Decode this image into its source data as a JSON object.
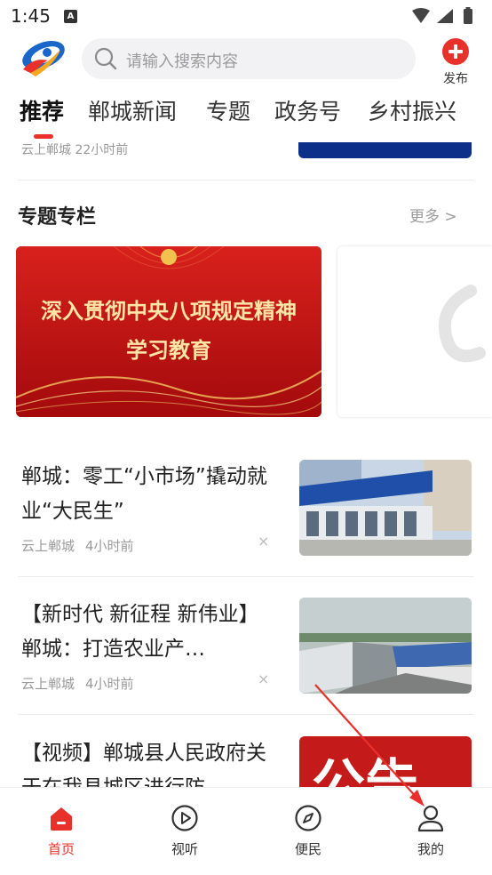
{
  "status_bar": {
    "time": "1:45",
    "notification_letter": "A"
  },
  "header": {
    "search_placeholder": "请输入搜索内容",
    "publish_label": "发布",
    "logo_icon": "app-logo-icon"
  },
  "tabs": [
    {
      "label": "推荐",
      "active": true
    },
    {
      "label": "郸城新闻",
      "active": false
    },
    {
      "label": "专题",
      "active": false
    },
    {
      "label": "政务号",
      "active": false
    },
    {
      "label": "乡村振兴",
      "active": false
    }
  ],
  "previous_item": {
    "meta": "云上郸城  22小时前"
  },
  "topics": {
    "title": "专题专栏",
    "more_label": "更多 >",
    "banner_line1": "深入贯彻中央八项规定精神",
    "banner_line2": "学习教育"
  },
  "news": [
    {
      "title": "郸城：零工“小市场”撬动就业“大民生”",
      "source": "云上郸城",
      "time": "4小时前",
      "close": "×"
    },
    {
      "title": "【新时代 新征程 新伟业】郸城：打造农业产…",
      "source": "云上郸城",
      "time": "4小时前",
      "close": "×"
    },
    {
      "title": "【视频】郸城县人民政府关于在我县城区进行防",
      "source": "",
      "time": "",
      "close": ""
    }
  ],
  "thumb3_text": "公告",
  "bottom_nav": [
    {
      "label": "首页",
      "icon": "home-icon",
      "active": true
    },
    {
      "label": "视听",
      "icon": "play-icon",
      "active": false
    },
    {
      "label": "便民",
      "icon": "compass-icon",
      "active": false
    },
    {
      "label": "我的",
      "icon": "user-icon",
      "active": false
    }
  ],
  "colors": {
    "accent": "#e8312b",
    "banner_red": "#c3100f",
    "banner_text": "#ffe6a6"
  }
}
